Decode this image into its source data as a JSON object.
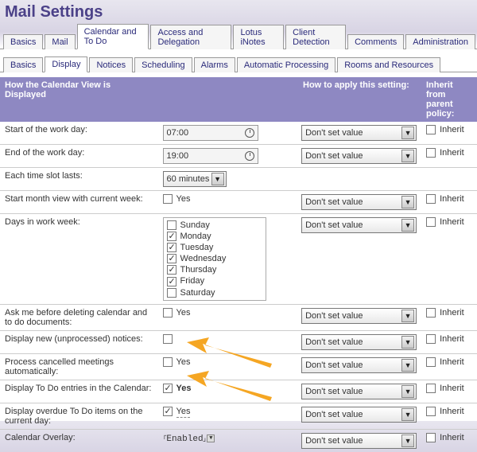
{
  "page_title": "Mail Settings",
  "main_tabs": [
    "Basics",
    "Mail",
    "Calendar and To Do",
    "Access and Delegation",
    "Lotus iNotes",
    "Client Detection",
    "Comments",
    "Administration"
  ],
  "main_active": 2,
  "sub_tabs": [
    "Basics",
    "Display",
    "Notices",
    "Scheduling",
    "Alarms",
    "Automatic Processing",
    "Rooms and Resources"
  ],
  "sub_active": 1,
  "header": {
    "c1": "How the Calendar View is Displayed",
    "c3": "How to apply this setting:",
    "c4": "Inherit from parent policy:"
  },
  "dd_default": "Don't set value",
  "inherit_label": "Inherit",
  "rows": {
    "start": {
      "label": "Start of the work day:",
      "time": "07:00"
    },
    "end": {
      "label": "End of the work day:",
      "time": "19:00"
    },
    "slot": {
      "label": "Each time slot lasts:",
      "value": "60 minutes"
    },
    "startmonth": {
      "label": "Start month view with current week:",
      "yes": "Yes",
      "checked": false
    },
    "days": {
      "label": "Days in work week:"
    },
    "askdel": {
      "label": "Ask me before deleting calendar and to do documents:",
      "yes": "Yes",
      "checked": false
    },
    "dispnew": {
      "label": "Display new (unprocessed) notices:",
      "yes": "",
      "checked": false
    },
    "proc": {
      "label": "Process cancelled meetings automatically:",
      "yes": "Yes",
      "checked": false
    },
    "disptodo": {
      "label": "Display To Do entries in the Calendar:",
      "yes": "Yes",
      "checked": true
    },
    "dispoverdue": {
      "label": "Display overdue To Do items on the current day:",
      "yes": "Yes",
      "checked": true
    },
    "overlay": {
      "label": "Calendar Overlay:",
      "value": "Enabled"
    }
  },
  "days_list": [
    {
      "name": "Sunday",
      "checked": false
    },
    {
      "name": "Monday",
      "checked": true
    },
    {
      "name": "Tuesday",
      "checked": true
    },
    {
      "name": "Wednesday",
      "checked": true
    },
    {
      "name": "Thursday",
      "checked": true
    },
    {
      "name": "Friday",
      "checked": true
    },
    {
      "name": "Saturday",
      "checked": false
    }
  ]
}
